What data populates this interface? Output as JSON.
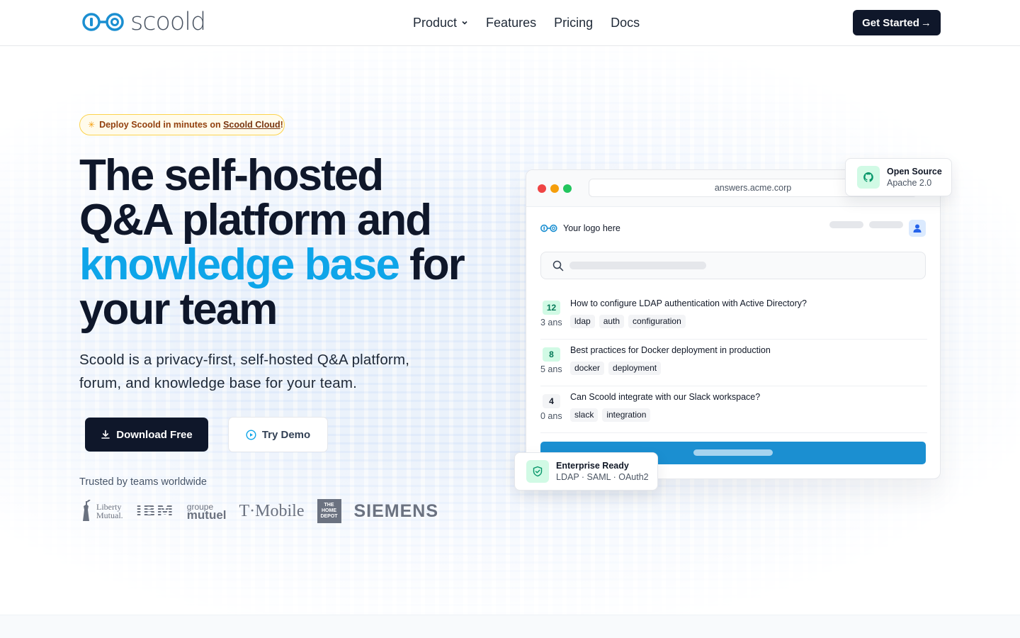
{
  "nav": {
    "logo_text": "scoold",
    "links": [
      "Product",
      "Features",
      "Pricing",
      "Docs"
    ],
    "cta_label": "Get Started",
    "cta_arrow": "→"
  },
  "hero": {
    "announce": {
      "prefix": "Deploy Scoold in minutes on ",
      "link": "Scoold Cloud",
      "suffix": "!"
    },
    "headline": {
      "line1": "The self-hosted",
      "line2": "Q&A platform and",
      "accent": "knowledge base",
      "after_accent": " for",
      "line4": "your team"
    },
    "subhead": "Scoold is a privacy-first, self-hosted Q&A platform, forum, and knowledge base for your team.",
    "primary_button": "Download Free",
    "secondary_button": "Try Demo",
    "trusted_label": "Trusted by teams worldwide",
    "logos": {
      "liberty_1": "Liberty",
      "liberty_2": "Mutual.",
      "ibm": "IBM",
      "mutuel_1": "groupe",
      "mutuel_2": "mutuel",
      "tmobile": "T·Mobile",
      "homedepot": "THE HOME DEPOT",
      "siemens": "SIEMENS"
    }
  },
  "mockup": {
    "url": "answers.acme.corp",
    "app_logo_text": "Your logo here",
    "questions": [
      {
        "votes": "12",
        "answers": "3 ans",
        "title": "How to configure LDAP authentication with Active Directory?",
        "tags": [
          "ldap",
          "auth",
          "configuration"
        ],
        "vote_bg": "#d1fae5",
        "vote_fg": "#047857"
      },
      {
        "votes": "8",
        "answers": "5 ans",
        "title": "Best practices for Docker deployment in production",
        "tags": [
          "docker",
          "deployment"
        ],
        "vote_bg": "#d1fae5",
        "vote_fg": "#047857"
      },
      {
        "votes": "4",
        "answers": "0 ans",
        "title": "Can Scoold integrate with our Slack workspace?",
        "tags": [
          "slack",
          "integration"
        ],
        "vote_bg": "#f3f4f6",
        "vote_fg": "#111827"
      }
    ]
  },
  "badges": {
    "open_source": {
      "title": "Open Source",
      "subtitle": "Apache 2.0"
    },
    "enterprise": {
      "title": "Enterprise Ready",
      "subtitle": "LDAP · SAML · OAuth2"
    }
  },
  "colors": {
    "accent": "#0ea5e9",
    "dark": "#0f172a",
    "mock_button": "#1b8fd1",
    "dot_red": "#ef4444",
    "dot_yellow": "#f59e0b",
    "dot_green": "#22c55e"
  }
}
